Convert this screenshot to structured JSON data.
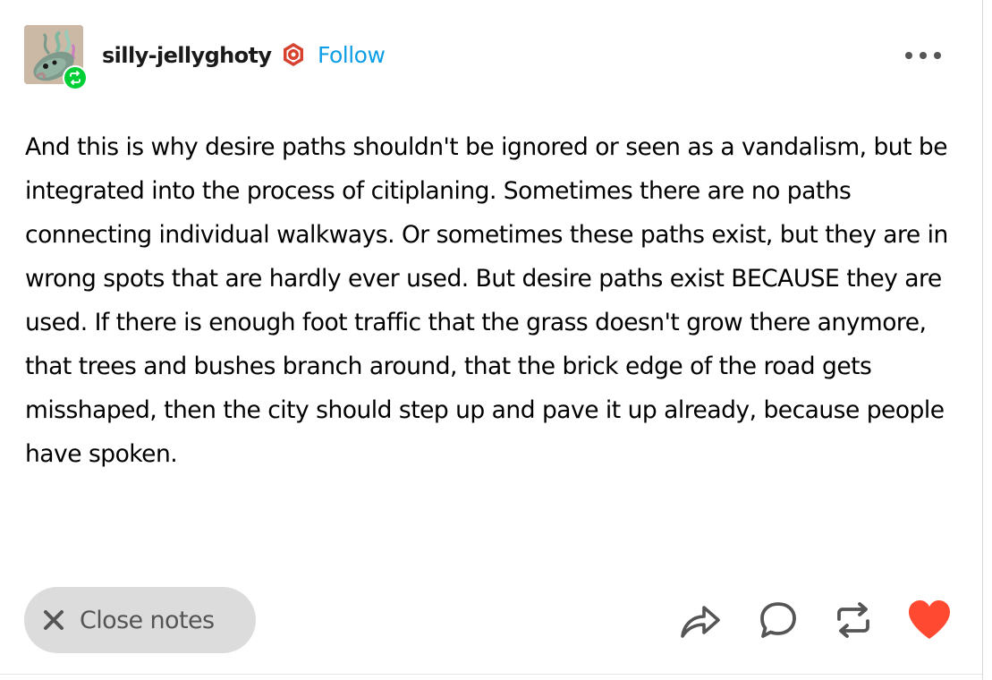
{
  "post": {
    "username": "silly-jellyghoty",
    "follow_label": "Follow",
    "text": "And this is why desire paths shouldn't be ignored or seen as a vandalism, but be integrated into the process of citiplaning. Sometimes there are no paths connecting individual walkways. Or sometimes these paths exist, but they are in wrong spots that are hardly ever used. But desire paths exist BECAUSE they are used. If there is enough foot traffic that the grass doesn't grow there anymore, that trees and bushes branch around, that the brick edge of the road gets misshaped, then the city should step up and pave it up already, because people have spoken."
  },
  "footer": {
    "close_notes_label": "Close notes",
    "actions": {
      "share": "share-icon",
      "reply": "reply-icon",
      "reblog": "reblog-icon",
      "like": "heart-icon"
    }
  },
  "icons": {
    "avatar": "avatar",
    "reblog_badge": "reblog-badge-icon",
    "blog_badge": "blog-badge-icon",
    "more": "more-options-icon",
    "close": "close-icon"
  },
  "colors": {
    "follow": "#0d9ee6",
    "like": "#ff4930",
    "reblog_badge": "#00cf35",
    "close_notes_bg": "#dcdcdc",
    "badge": "#d7422f"
  }
}
